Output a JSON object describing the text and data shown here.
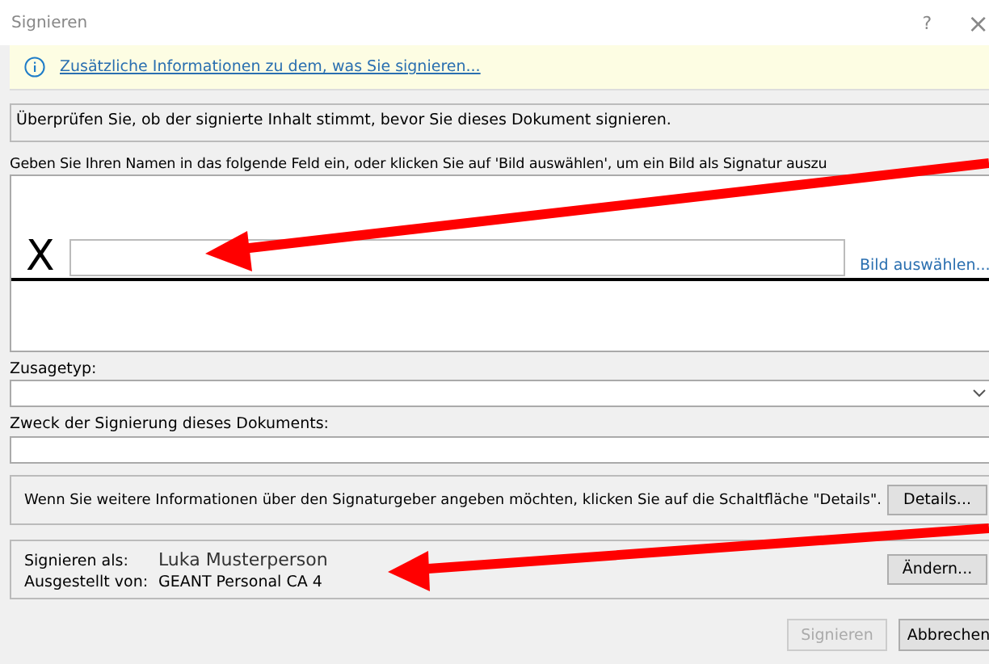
{
  "window": {
    "title": "Signieren",
    "help": "?",
    "close": "×"
  },
  "info_bar": {
    "link": "Zusätzliche Informationen zu dem, was Sie signieren..."
  },
  "verify_notice": "Überprüfen Sie, ob der signierte Inhalt stimmt, bevor Sie dieses Dokument signieren.",
  "signature": {
    "instruction": "Geben Sie Ihren Namen in das folgende Feld ein, oder klicken Sie auf 'Bild auswählen', um ein Bild als Signatur auszu",
    "mark": "X",
    "select_image": "Bild auswählen..."
  },
  "commitment_type": {
    "label": "Zusagetyp:"
  },
  "purpose": {
    "label": "Zweck der Signierung dieses Dokuments:"
  },
  "details": {
    "text": "Wenn Sie weitere Informationen über den Signaturgeber angeben möchten, klicken Sie auf die Schaltfläche \"Details\".",
    "button": "Details..."
  },
  "signer": {
    "signing_as_label": "Signieren als:",
    "signing_as": "Luka Musterperson",
    "issued_by_label": "Ausgestellt von:",
    "issued_by": "GEANT Personal CA 4",
    "change_button": "Ändern..."
  },
  "buttons": [
    {
      "label": "Signieren",
      "disabled": true
    },
    {
      "label": "Abbrechen",
      "disabled": false
    }
  ]
}
